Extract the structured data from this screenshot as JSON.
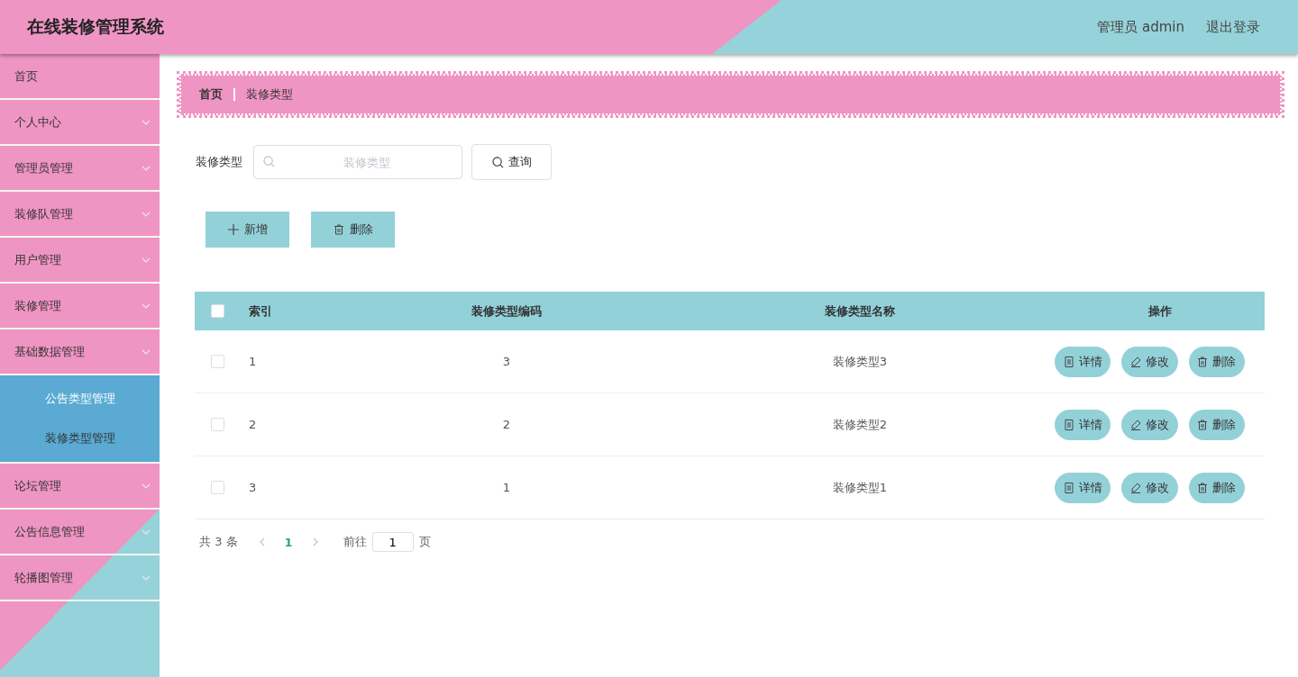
{
  "header": {
    "title": "在线装修管理系统",
    "user_label": "管理员 admin",
    "logout": "退出登录"
  },
  "sidebar": {
    "items": [
      {
        "label": "首页",
        "kind": "link"
      },
      {
        "label": "个人中心",
        "kind": "menu"
      },
      {
        "label": "管理员管理",
        "kind": "menu"
      },
      {
        "label": "装修队管理",
        "kind": "menu"
      },
      {
        "label": "用户管理",
        "kind": "menu"
      },
      {
        "label": "装修管理",
        "kind": "menu"
      },
      {
        "label": "基础数据管理",
        "kind": "menu",
        "children": [
          {
            "label": "公告类型管理",
            "selected": true
          },
          {
            "label": "装修类型管理",
            "selected": false
          }
        ]
      },
      {
        "label": "论坛管理",
        "kind": "menu"
      },
      {
        "label": "公告信息管理",
        "kind": "menu"
      },
      {
        "label": "轮播图管理",
        "kind": "menu"
      }
    ]
  },
  "breadcrumb": [
    "首页",
    "装修类型"
  ],
  "search": {
    "label": "装修类型",
    "placeholder": "装修类型",
    "button": "查询"
  },
  "actions": [
    {
      "label": "新增",
      "kind": "add"
    },
    {
      "label": "删除",
      "kind": "delete"
    }
  ],
  "table": {
    "select_all": {
      "checked": false
    },
    "columns": [
      "索引",
      "装修类型编码",
      "装修类型名称",
      "操作"
    ],
    "rows": [
      {
        "checked": false,
        "cells": [
          "1",
          "3",
          "装修类型3"
        ],
        "actions": [
          {
            "label": "详情",
            "kind": "detail"
          },
          {
            "label": "修改",
            "kind": "edit"
          },
          {
            "label": "删除",
            "kind": "delete"
          }
        ]
      },
      {
        "checked": false,
        "cells": [
          "2",
          "2",
          "装修类型2"
        ],
        "actions": [
          {
            "label": "详情",
            "kind": "detail"
          },
          {
            "label": "修改",
            "kind": "edit"
          },
          {
            "label": "删除",
            "kind": "delete"
          }
        ]
      },
      {
        "checked": false,
        "cells": [
          "3",
          "1",
          "装修类型1"
        ],
        "actions": [
          {
            "label": "详情",
            "kind": "detail"
          },
          {
            "label": "修改",
            "kind": "edit"
          },
          {
            "label": "删除",
            "kind": "delete"
          }
        ]
      }
    ]
  },
  "pagination": {
    "total": "共 3 条",
    "pages": [
      {
        "label": "1",
        "selected": true
      }
    ],
    "goto_label": "前往",
    "goto_value": "1",
    "suffix": "页"
  }
}
